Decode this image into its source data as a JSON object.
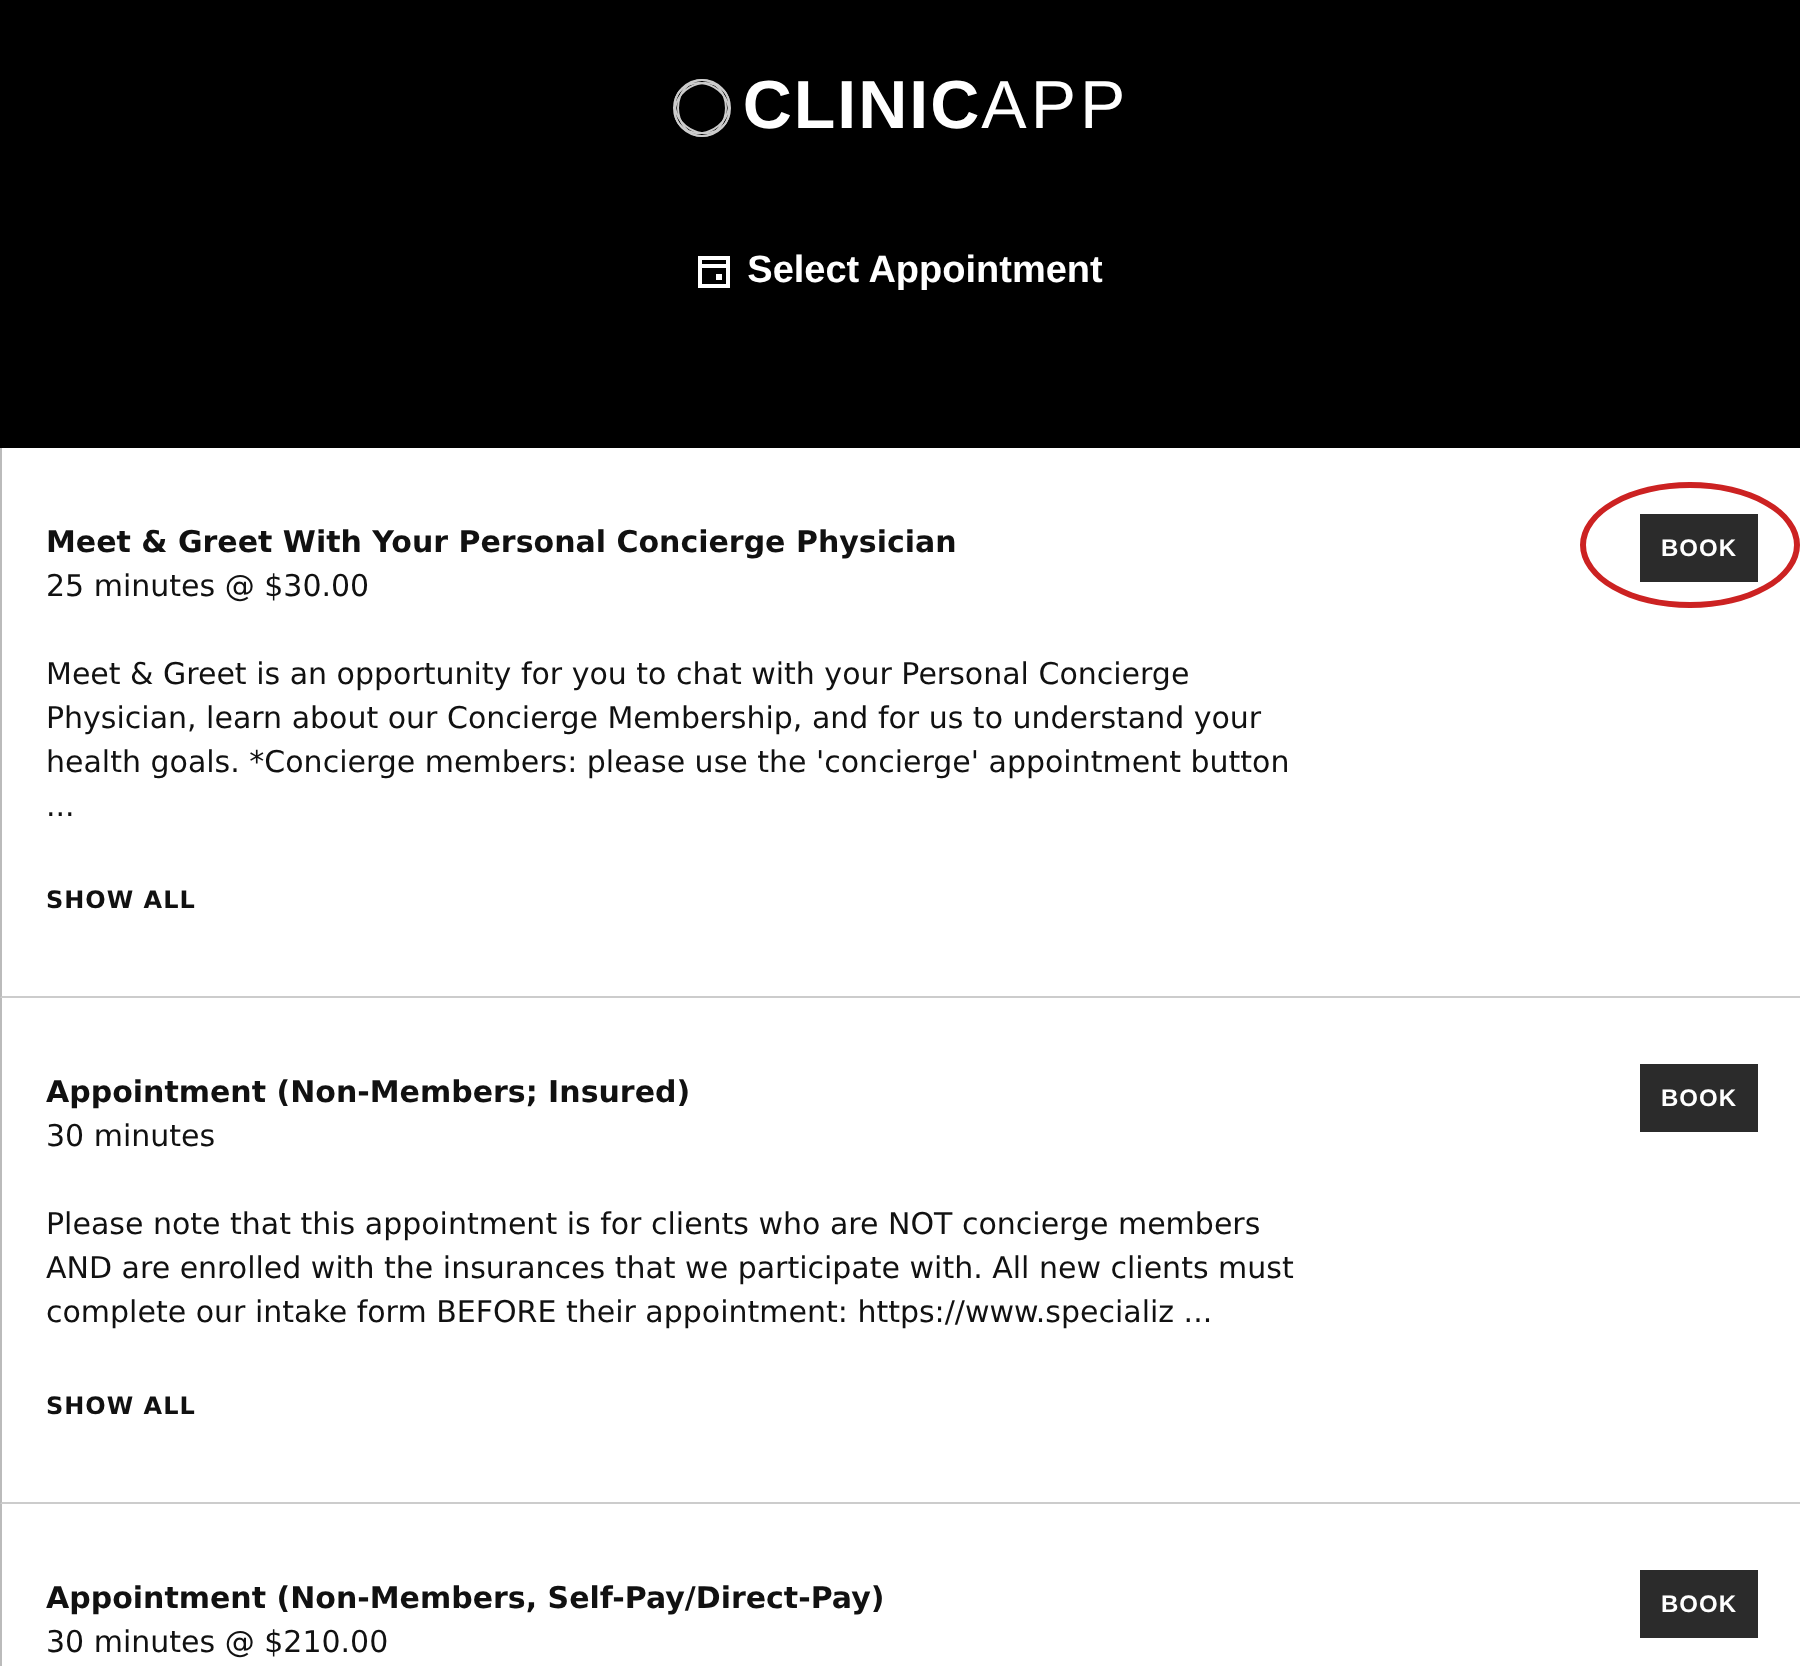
{
  "header": {
    "logo_bold": "CLINIC",
    "logo_light": "APP",
    "title": "Select Appointment"
  },
  "appointments": [
    {
      "title": "Meet & Greet With Your Personal Concierge Physician",
      "duration": "25 minutes @ $30.00",
      "description": "Meet & Greet is an opportunity for you to chat with your Personal Concierge Physician, learn about our Concierge Membership, and for us to understand your health goals. *Concierge members: please use the 'concierge' appointment button ...",
      "show_all": "SHOW ALL",
      "button": "BOOK",
      "highlighted": true
    },
    {
      "title": "Appointment (Non-Members; Insured)",
      "duration": "30 minutes",
      "description": "Please note that this appointment is for clients who are NOT concierge members AND are enrolled with the insurances that we participate with. All new clients must complete our intake form BEFORE their appointment: https://www.specializ ...",
      "show_all": "SHOW ALL",
      "button": "BOOK",
      "highlighted": false
    },
    {
      "title": "Appointment (Non-Members, Self-Pay/Direct-Pay)",
      "duration": "30 minutes @ $210.00",
      "button": "BOOK",
      "highlighted": false
    }
  ]
}
